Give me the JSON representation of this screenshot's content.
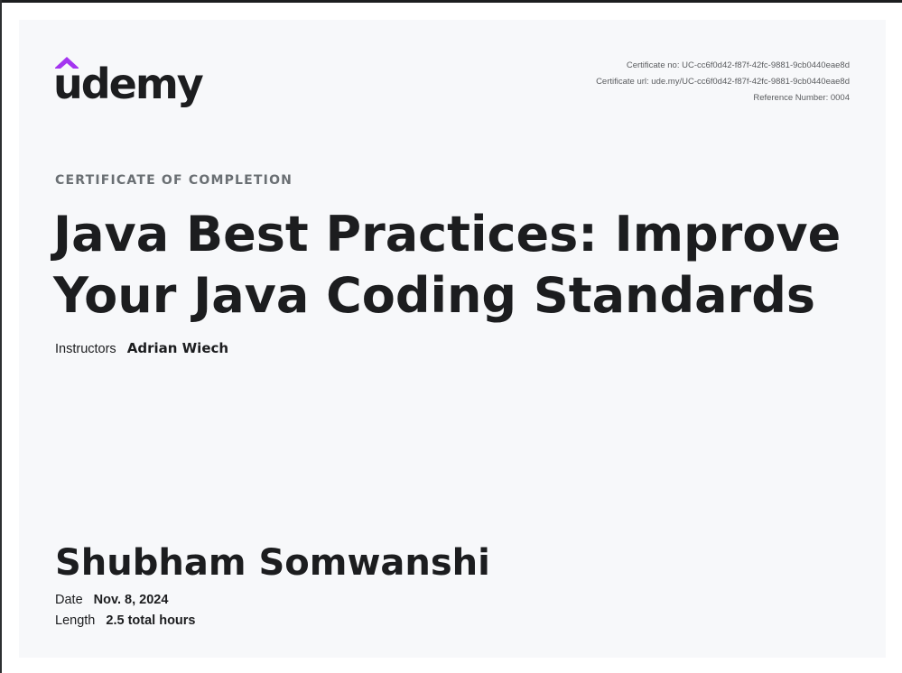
{
  "brand": {
    "logo_text": "udemy",
    "logo_icon": "udemy-chevron-icon",
    "accent_color": "#a435f0"
  },
  "certificate": {
    "number_line": "Certificate no: UC-cc6f0d42-f87f-42fc-9881-9cb0440eae8d",
    "url_line": "Certificate url: ude.my/UC-cc6f0d42-f87f-42fc-9881-9cb0440eae8d",
    "reference_line": "Reference Number: 0004",
    "eyebrow": "CERTIFICATE OF COMPLETION",
    "title_line_1": "Java Best Practices: Improve",
    "title_line_2": "Your Java Coding Standards",
    "instructors_label": "Instructors",
    "instructors_value": "Adrian Wiech",
    "recipient": "Shubham Somwanshi",
    "date_label": "Date",
    "date_value": "Nov. 8, 2024",
    "length_label": "Length",
    "length_value": "2.5 total hours"
  }
}
